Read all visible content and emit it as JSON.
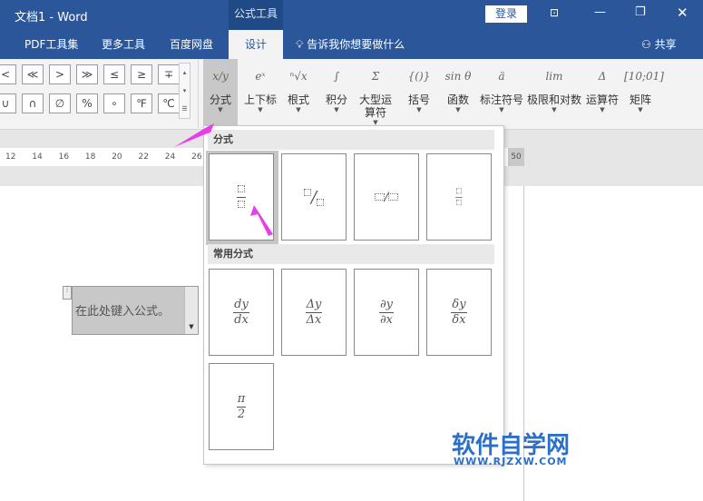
{
  "window": {
    "title": "文档1  -  Word",
    "context_tab": "公式工具",
    "login": "登录"
  },
  "tabs": [
    {
      "label": "PDF工具集"
    },
    {
      "label": "更多工具"
    },
    {
      "label": "百度网盘"
    },
    {
      "label": "设计",
      "active": true
    }
  ],
  "tell_me": "告诉我你想要做什么",
  "share": "共享",
  "symbols_row1": [
    "<",
    "≪",
    ">",
    "≫",
    "≤",
    "≥",
    "∓"
  ],
  "symbols_row2": [
    "∪",
    "∩",
    "∅",
    "%",
    "∘",
    "℉",
    "℃"
  ],
  "groups": [
    {
      "icon": "x/y",
      "label": "分式"
    },
    {
      "icon": "eˣ",
      "label": "上下标"
    },
    {
      "icon": "ⁿ√x",
      "label": "根式"
    },
    {
      "icon": "∫",
      "label": "积分"
    },
    {
      "icon": "Σ",
      "label": "大型运算符"
    },
    {
      "icon": "{()}",
      "label": "括号"
    },
    {
      "icon": "sin θ",
      "label": "函数"
    },
    {
      "icon": "ä",
      "label": "标注符号"
    },
    {
      "icon": "lim",
      "label": "极限和对数"
    },
    {
      "icon": "Δ",
      "label": "运算符"
    },
    {
      "icon": "[10;01]",
      "label": "矩阵"
    }
  ],
  "ruler": [
    "12",
    "14",
    "16",
    "18",
    "20",
    "22",
    "24",
    "26",
    "50"
  ],
  "panel": {
    "section1": "分式",
    "section2": "常用分式",
    "common": [
      {
        "num": "dy",
        "den": "dx"
      },
      {
        "num": "Δy",
        "den": "Δx"
      },
      {
        "num": "∂y",
        "den": "∂x"
      },
      {
        "num": "δy",
        "den": "δx"
      },
      {
        "num": "π",
        "den": "2"
      }
    ]
  },
  "equation_placeholder": "在此处键入公式。",
  "watermark": {
    "title": "软件自学网",
    "url": "WWW.RJZXW.COM"
  },
  "colors": {
    "titlebar": "#2b579a",
    "arrow": "#e83ee8"
  }
}
